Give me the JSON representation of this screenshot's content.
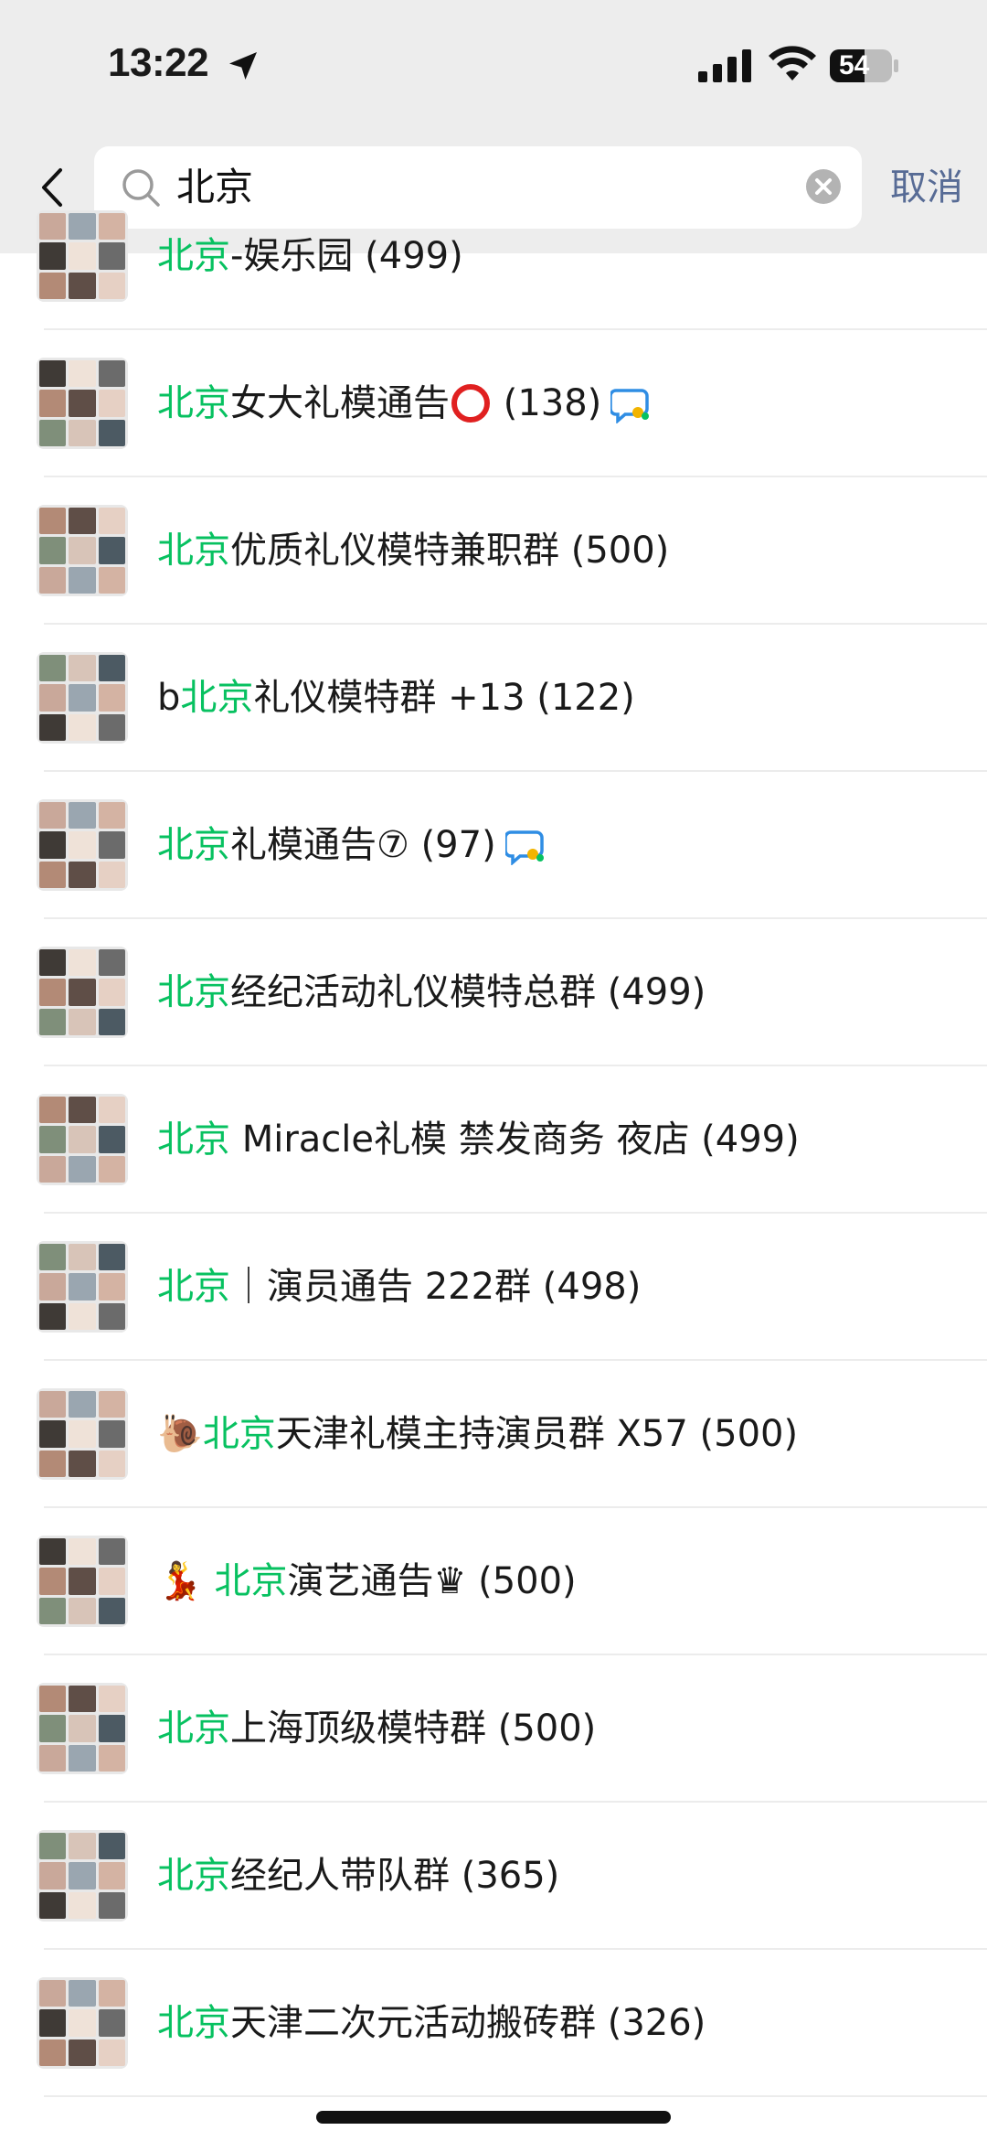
{
  "status_bar": {
    "time": "13:22",
    "battery": "54"
  },
  "search": {
    "query": "北京",
    "cancel_label": "取消"
  },
  "results": [
    {
      "pre": "",
      "highlight": "北京",
      "rest": "-娱乐园 (499)"
    },
    {
      "pre": "",
      "highlight": "北京",
      "rest": "女大礼模通告",
      "circle": true,
      "rest2": " (138)",
      "chat_icon": true
    },
    {
      "pre": "",
      "highlight": "北京",
      "rest": "优质礼仪模特兼职群 (500)"
    },
    {
      "pre": "b",
      "highlight": "北京",
      "rest": "礼仪模特群 +13 (122)"
    },
    {
      "pre": "",
      "highlight": "北京",
      "rest": "礼模通告⑦ (97)",
      "chat_icon": true
    },
    {
      "pre": "",
      "highlight": "北京",
      "rest": "经纪活动礼仪模特总群 (499)"
    },
    {
      "pre": "",
      "highlight": "北京",
      "rest": " Miracle礼模 禁发商务 夜店 (499)"
    },
    {
      "pre": "",
      "highlight": "北京",
      "rest": "｜演员通告 222群 (498)"
    },
    {
      "pre": "🐌",
      "highlight": "北京",
      "rest": "天津礼模主持演员群 X57 (500)"
    },
    {
      "pre": "💃 ",
      "highlight": "北京",
      "rest": "演艺通告♛ (500)"
    },
    {
      "pre": "",
      "highlight": "北京",
      "rest": "上海顶级模特群 (500)"
    },
    {
      "pre": "",
      "highlight": "北京",
      "rest": "经纪人带队群 (365)"
    },
    {
      "pre": "",
      "highlight": "北京",
      "rest": "天津二次元活动搬砖群 (326)"
    }
  ],
  "colors": {
    "highlight": "#07c160",
    "link": "#576b95",
    "header_bg": "#ededed"
  },
  "icons": [
    "back-arrow-icon",
    "search-icon",
    "clear-icon",
    "location-arrow-icon",
    "signal-icon",
    "wifi-icon",
    "battery-icon",
    "chat-bubble-icon"
  ]
}
